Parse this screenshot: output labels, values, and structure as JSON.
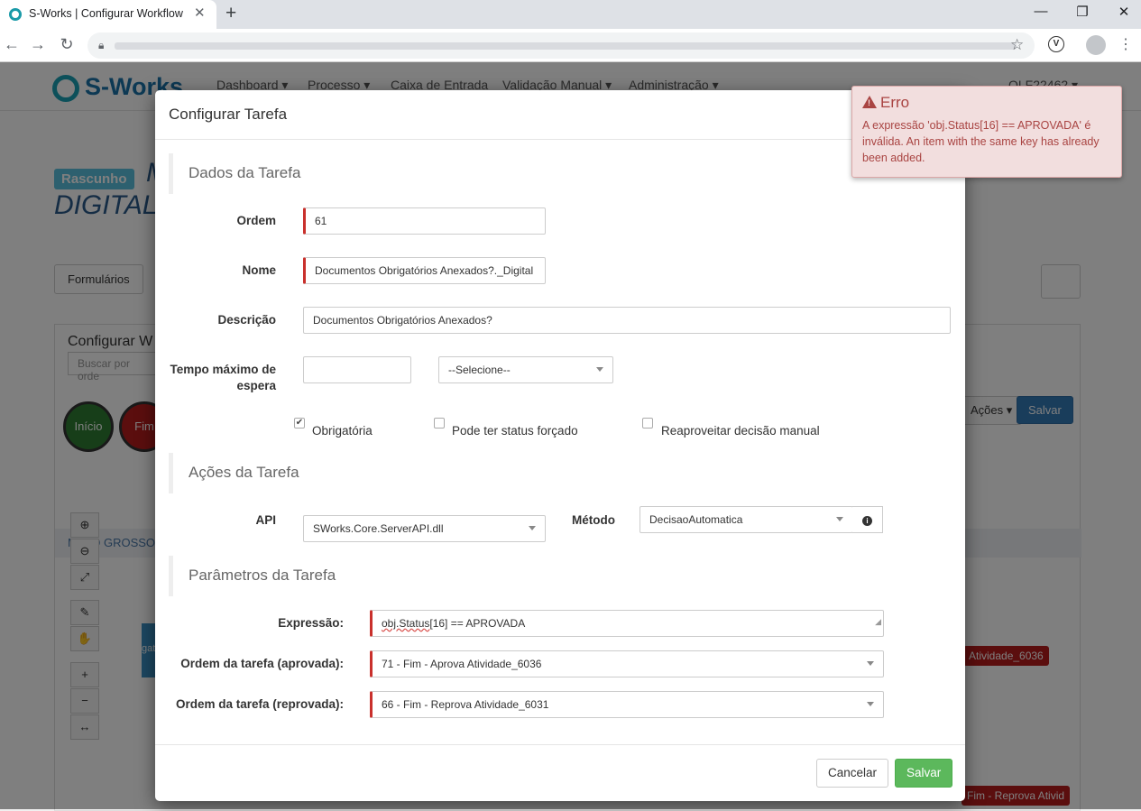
{
  "browser": {
    "tab_title": "S-Works | Configurar Workflow",
    "tab_close": "✕",
    "new_tab": "+",
    "minimize": "—",
    "restore": "❐",
    "close": "✕",
    "back": "←",
    "forward": "→",
    "reload": "↻",
    "star": "☆",
    "menu": "⋮",
    "ext": "V"
  },
  "app": {
    "logo": "S-Works",
    "nav": [
      "Dashboard ▾",
      "Processo ▾",
      "Caixa de Entrada",
      "Validação Manual ▾",
      "Administração ▾"
    ],
    "user": "OLF22462 ▾",
    "draft_badge": "Rascunho",
    "title_line1": "M",
    "title_line2": "DIGITAL",
    "btn_forms": "Formulários",
    "panel_title": "Configurar W",
    "search_placeholder": "Buscar por orde",
    "btn_actions": "Ações ▾",
    "btn_save": "Salvar",
    "node_start": "Início",
    "node_end": "Fim",
    "region": "MATO GROSSO",
    "tag_approve": "Atividade_6036",
    "tag_reject": "Fim - Reprova Ativid",
    "side_label": "gat",
    "zoom_tools": [
      "⊕",
      "⊖",
      "⤢",
      "✎",
      "✋",
      "+",
      "−",
      "↔"
    ]
  },
  "modal": {
    "title": "Configurar Tarefa",
    "section_data": "Dados da Tarefa",
    "label_order": "Ordem",
    "order_value": "61",
    "label_name": "Nome",
    "name_value": "Documentos Obrigatórios Anexados?._Digital",
    "label_desc": "Descrição",
    "desc_value": "Documentos Obrigatórios Anexados?",
    "label_wait_1": "Tempo máximo de",
    "label_wait_2": "espera",
    "wait_value": "",
    "wait_unit": "--Selecione--",
    "chk_required": "Obrigatória",
    "chk_required_checked": true,
    "chk_forced": "Pode ter status forçado",
    "chk_reuse": "Reaproveitar decisão manual",
    "section_actions": "Ações da Tarefa",
    "label_api": "API",
    "api_value": "SWorks.Core.ServerAPI.dll",
    "label_method": "Método",
    "method_value": "DecisaoAutomatica",
    "section_params": "Parâmetros da Tarefa",
    "label_expr": "Expressão:",
    "expr_value_a": "obj.Status",
    "expr_value_b": "[16] == APROVADA",
    "label_approved": "Ordem da tarefa (aprovada):",
    "approved_value": "71 - Fim - Aprova Atividade_6036",
    "label_rejected": "Ordem da tarefa (reprovada):",
    "rejected_value": "66 - Fim - Reprova Atividade_6031",
    "btn_cancel": "Cancelar",
    "btn_save": "Salvar"
  },
  "toast": {
    "title": "Erro",
    "message": "A expressão 'obj.Status[16] == APROVADA' é inválida. An item with the same key has already been added."
  },
  "colors": {
    "required_marker": "#c9302c",
    "success": "#5cb85c",
    "error_bg": "#f2dede",
    "error_text": "#a94442"
  }
}
